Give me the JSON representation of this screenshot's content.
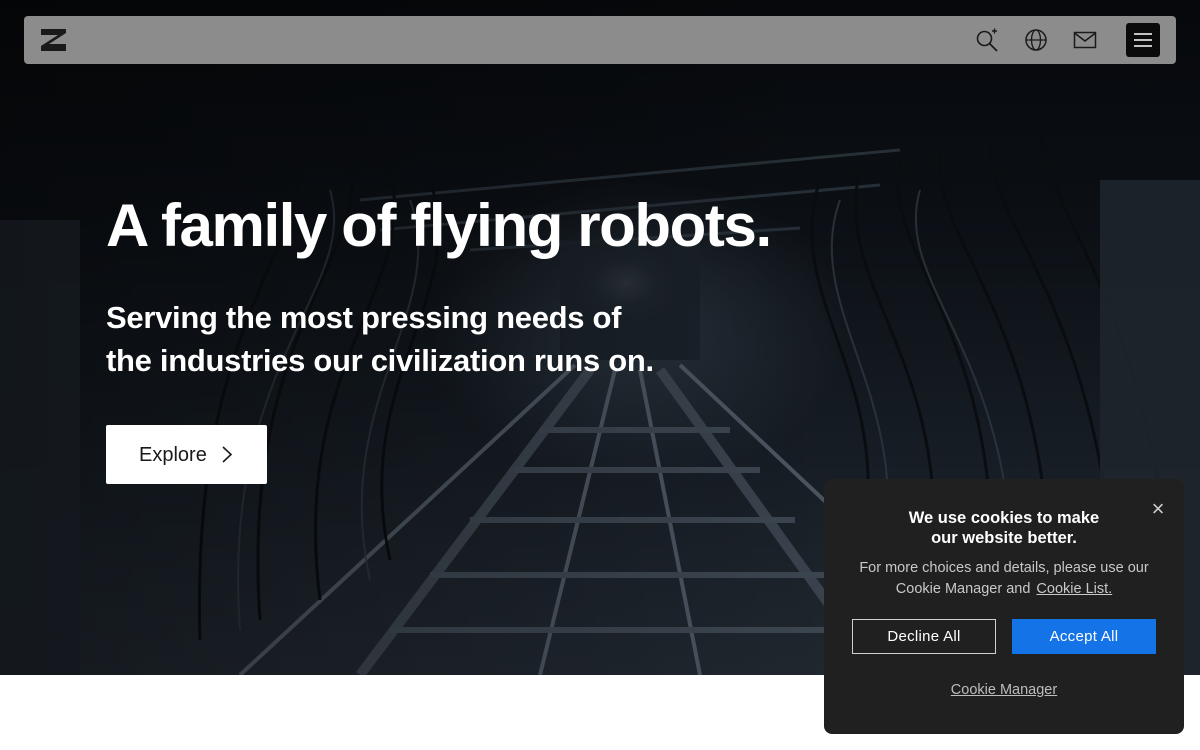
{
  "nav": {
    "logo_icon": "brand-logo-icon",
    "icons": [
      "search-sparkle-icon",
      "globe-icon",
      "mail-icon",
      "hamburger-menu-icon"
    ],
    "background": "#8c8c8c"
  },
  "hero": {
    "headline": "A family of flying robots.",
    "subline_1": "Serving the most pressing needs of",
    "subline_2": "the industries our civilization runs on.",
    "explore_label": "Explore",
    "explore_icon": "chevron-right-icon"
  },
  "cookie": {
    "title_1": "We use cookies to make",
    "title_2": "our website better.",
    "body": "For more choices and details, please use our Cookie Manager and",
    "link": "Cookie List.",
    "decline_label": "Decline All",
    "accept_label": "Accept All",
    "manager_label": "Cookie Manager",
    "close_icon": "close-icon",
    "accent": "#1473e6"
  }
}
